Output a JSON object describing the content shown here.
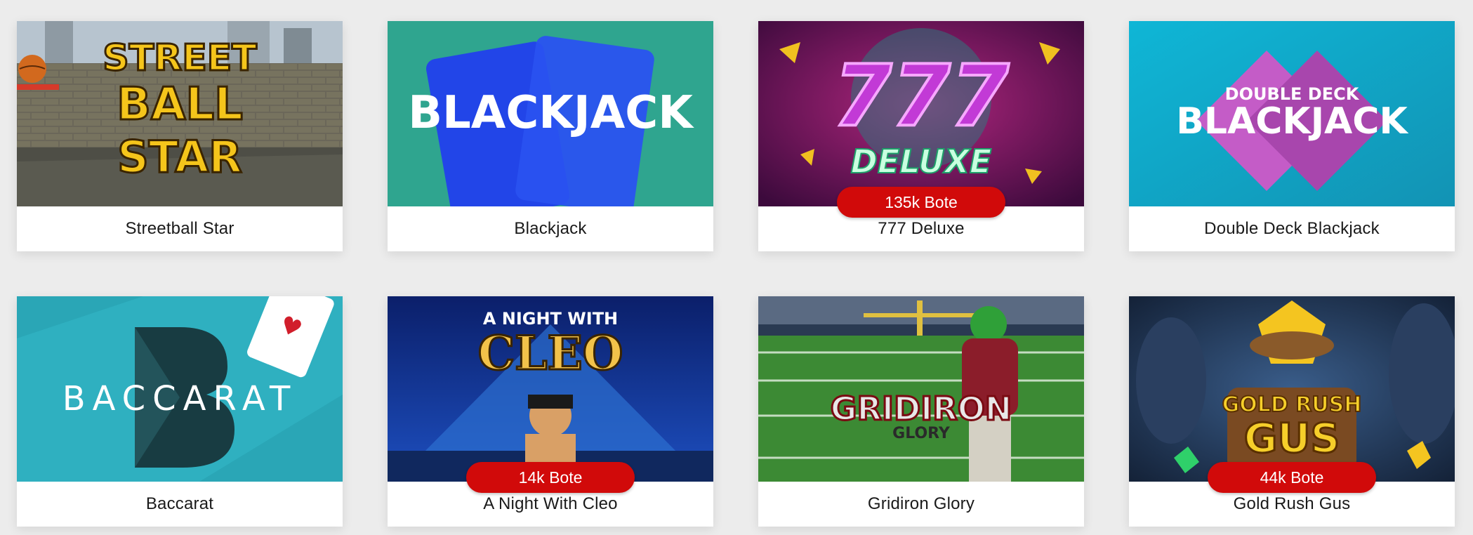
{
  "games": [
    {
      "title": "Streetball Star",
      "art_text": [
        "STREET",
        "BALL",
        "STAR"
      ],
      "jackpot": null
    },
    {
      "title": "Blackjack",
      "art_text": [
        "BLACKJACK"
      ],
      "jackpot": null
    },
    {
      "title": "777 Deluxe",
      "art_text": [
        "777",
        "DELUXE"
      ],
      "jackpot": "135k Bote"
    },
    {
      "title": "Double Deck Blackjack",
      "art_text": [
        "DOUBLE DECK",
        "BLACKJACK"
      ],
      "jackpot": null
    },
    {
      "title": "Baccarat",
      "art_text": [
        "BACCARAT"
      ],
      "jackpot": null
    },
    {
      "title": "A Night With Cleo",
      "art_text": [
        "A NIGHT WITH",
        "CLEO"
      ],
      "jackpot": "14k Bote"
    },
    {
      "title": "Gridiron Glory",
      "art_text": [
        "GRIDIRON",
        "GLORY"
      ],
      "jackpot": null
    },
    {
      "title": "Gold Rush Gus",
      "art_text": [
        "GOLD RUSH",
        "GUS"
      ],
      "jackpot": "44k Bote"
    }
  ],
  "colors": {
    "jackpot_badge": "#d10a0a",
    "page_background": "#ececec",
    "card_background": "#ffffff"
  }
}
